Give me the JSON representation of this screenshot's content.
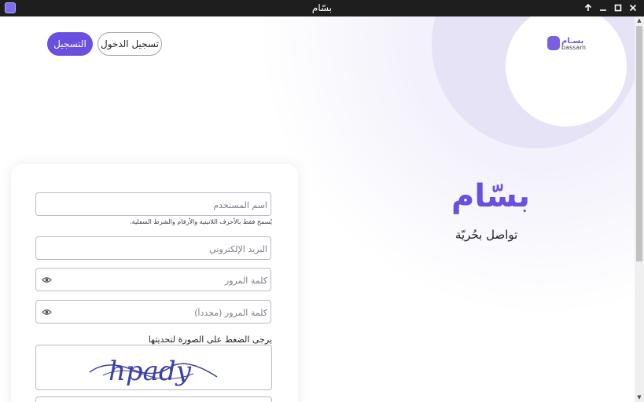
{
  "window": {
    "title": "بسّام"
  },
  "header": {
    "logo_text": "بسـام",
    "logo_sub": "bassam",
    "register_label": "التسجيل",
    "login_label": "تسجيل الدخول"
  },
  "hero": {
    "brand": "بسّام",
    "tagline": "تواصل بحُريّة"
  },
  "form": {
    "username_placeholder": "اسم المستخدم",
    "username_hint": "يُسمح فقط بالأحرف اللاتينية والأرقام والشرط السفلية.",
    "email_placeholder": "البريد الإلكتروني",
    "password_placeholder": "كلمة المرور",
    "password_confirm_placeholder": "كلمة المرور (مجدداً)",
    "captcha_label": "يرجى الضغط على الصورة لتحديثها",
    "captcha_text": "hpady"
  },
  "colors": {
    "accent": "#6a4fe0",
    "titlebar": "#1e1e1e"
  },
  "icons": [
    "app-icon",
    "up-arrow-icon",
    "minimize-icon",
    "maximize-icon",
    "close-icon",
    "eye-icon"
  ]
}
